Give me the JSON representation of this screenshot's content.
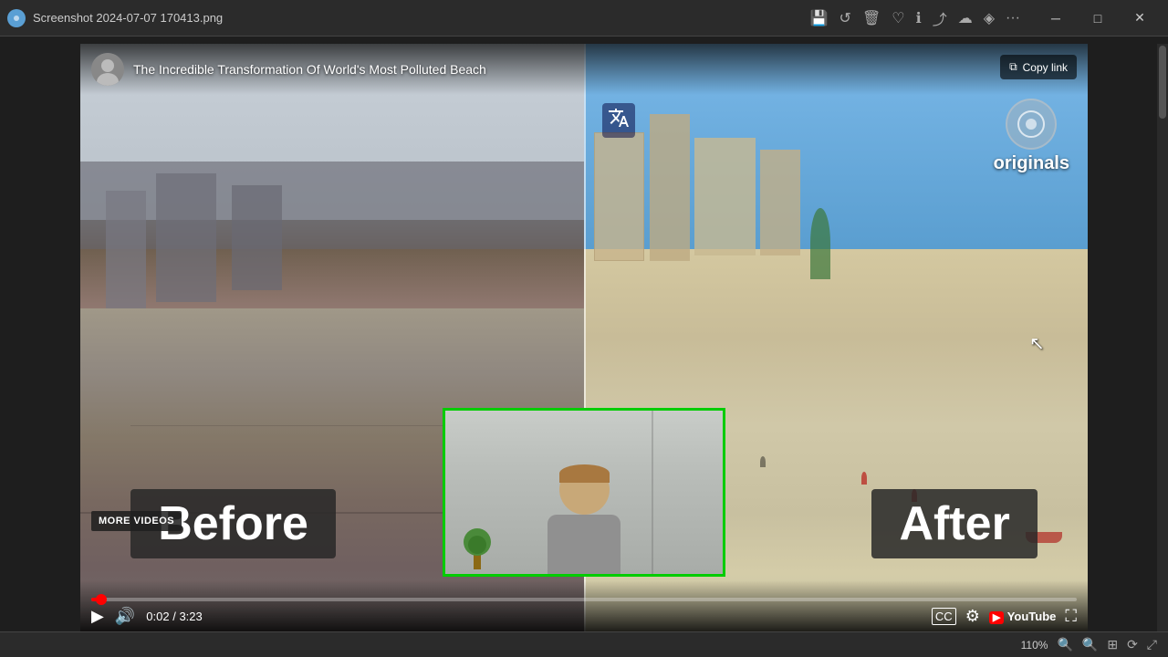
{
  "titlebar": {
    "filename": "Screenshot 2024-07-07 170413.png",
    "app_icon": "📷",
    "toolbar_icons": [
      "save",
      "rotate",
      "delete",
      "favorite",
      "info",
      "share",
      "cloud",
      "diamond",
      "more"
    ],
    "window_controls": [
      "minimize",
      "maximize",
      "close"
    ]
  },
  "video": {
    "title": "The Incredible Transformation Of World's Most Polluted Beach",
    "before_label": "Before",
    "after_label": "After",
    "more_videos_label": "MORE VIDEOS",
    "copy_link_label": "Copy link",
    "originals_label": "originals",
    "time_current": "0:02",
    "time_total": "3:23",
    "progress_percent": 1,
    "youtube_label": "YouTube"
  },
  "statusbar": {
    "zoom": "110%"
  }
}
